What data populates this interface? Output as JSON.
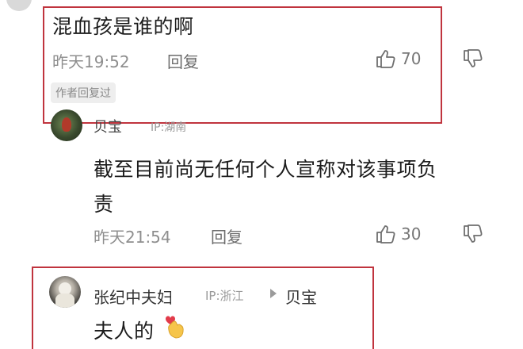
{
  "comments": [
    {
      "text": "混血孩是谁的啊",
      "time": "昨天19:52",
      "reply_label": "回复",
      "likes": "70",
      "author_reply_badge": "作者回复过"
    },
    {
      "author": "贝宝",
      "ip": "IP:湖南",
      "text_line1": "截至目前尚无任何个人宣称对该事项负",
      "text_line2": "责",
      "time": "昨天21:54",
      "reply_label": "回复",
      "likes": "30"
    },
    {
      "author": "张纪中夫妇",
      "ip": "IP:浙江",
      "reply_to": "贝宝",
      "text": "夫人的"
    }
  ],
  "colors": {
    "highlight": "#c0343e",
    "muted": "#8e8e8e"
  }
}
